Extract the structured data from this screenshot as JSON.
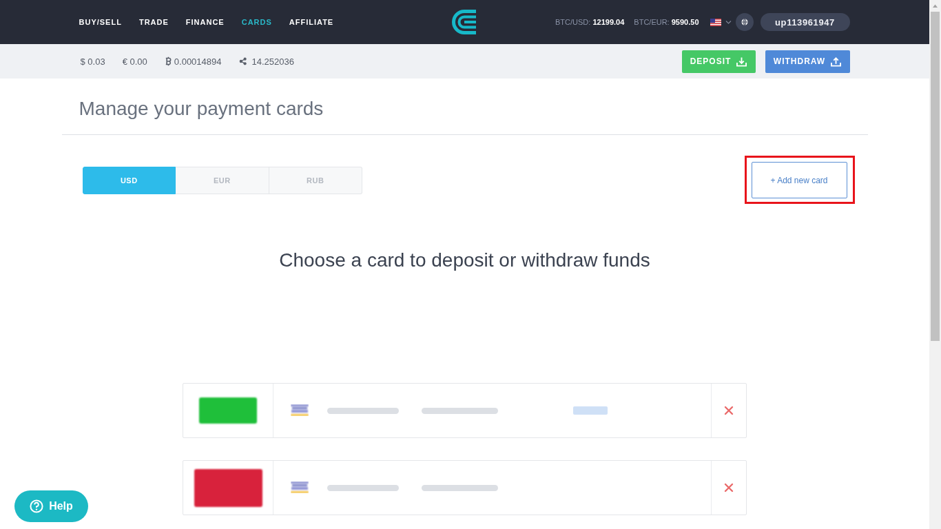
{
  "nav": {
    "items": [
      {
        "label": "BUY/SELL",
        "selected": false
      },
      {
        "label": "TRADE",
        "selected": false
      },
      {
        "label": "FINANCE",
        "selected": false
      },
      {
        "label": "CARDS",
        "selected": true
      },
      {
        "label": "AFFILIATE",
        "selected": false
      }
    ]
  },
  "rates": [
    {
      "label": "BTC/USD:",
      "value": "12199.04"
    },
    {
      "label": "BTC/EUR:",
      "value": "9590.50"
    }
  ],
  "user": {
    "name": "up113961947"
  },
  "balances": [
    {
      "kind": "symbol",
      "symbol": "$",
      "amount": "0.03"
    },
    {
      "kind": "symbol",
      "symbol": "€",
      "amount": "0.00"
    },
    {
      "kind": "bitcoin",
      "amount": "0.00014894"
    },
    {
      "kind": "ripple",
      "amount": "14.252036"
    }
  ],
  "actions": [
    {
      "kind": "deposit",
      "label": "DEPOSIT"
    },
    {
      "kind": "withdraw",
      "label": "WITHDRAW"
    }
  ],
  "page_title": "Manage your payment cards",
  "currency_tabs": [
    {
      "label": "USD",
      "selected": true
    },
    {
      "label": "EUR",
      "selected": false
    },
    {
      "label": "RUB",
      "selected": false
    }
  ],
  "add_card": {
    "label": "+ Add new card",
    "highlighted": true
  },
  "prompt": "Choose a card to deposit or withdraw funds",
  "cards": [
    {
      "verified": true,
      "deposit_link": true
    },
    {
      "verified": false,
      "deposit_link": false
    }
  ],
  "help": {
    "label": "Help"
  }
}
